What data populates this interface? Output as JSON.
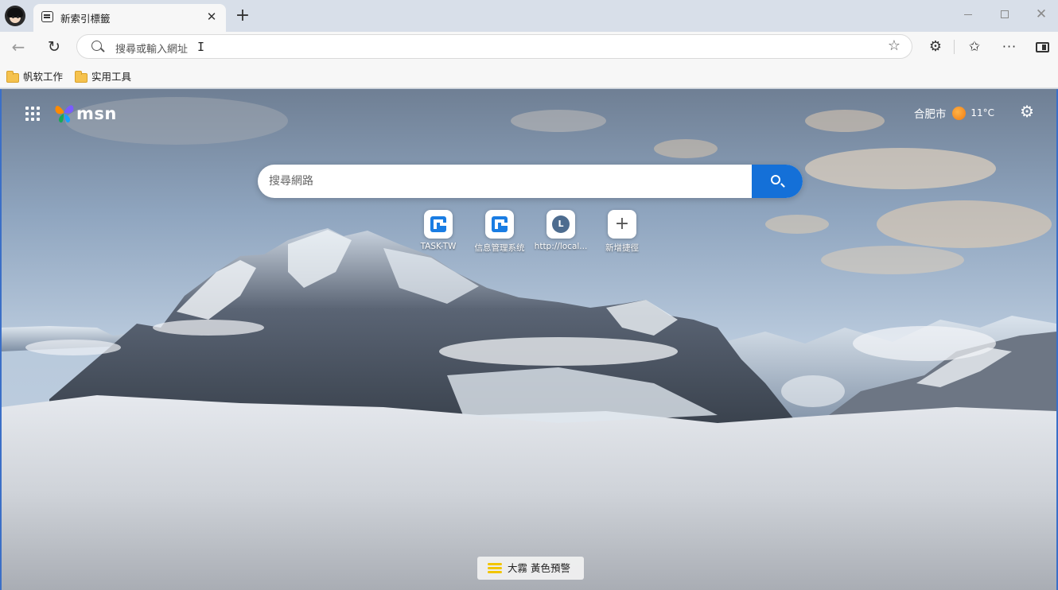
{
  "tab": {
    "title": "新索引標籤",
    "close": "✕",
    "new_tab": "+"
  },
  "window": {
    "close": "✕"
  },
  "toolbar": {
    "back": "←",
    "reload": "↻",
    "star": "☆",
    "extensions": "⚙",
    "favorites": "✩",
    "more": "···"
  },
  "address_bar": {
    "placeholder": "搜尋或輸入網址",
    "caret": "I"
  },
  "bookmarks": [
    {
      "label": "帆软工作"
    },
    {
      "label": "实用工具"
    }
  ],
  "msn": {
    "brand": "msn",
    "weather": {
      "city": "合肥市",
      "temp": "11°C"
    },
    "settings": "⚙",
    "search": {
      "placeholder": "搜尋網路"
    },
    "shortcuts": [
      {
        "label": "TASK-TW",
        "icon": "fanruan-icon"
      },
      {
        "label": "信息管理系统",
        "icon": "fanruan-icon"
      },
      {
        "label": "http://local...",
        "icon": "l-letter-icon",
        "letter": "L"
      },
      {
        "label": "新增捷徑",
        "icon": "plus-icon",
        "symbol": "+"
      }
    ],
    "alert": {
      "text": "大霧 黃色預警"
    }
  },
  "colors": {
    "accent": "#1470d8",
    "sun": "#f07a10",
    "haze": "#f2c500",
    "border": "#3b6fc7"
  }
}
